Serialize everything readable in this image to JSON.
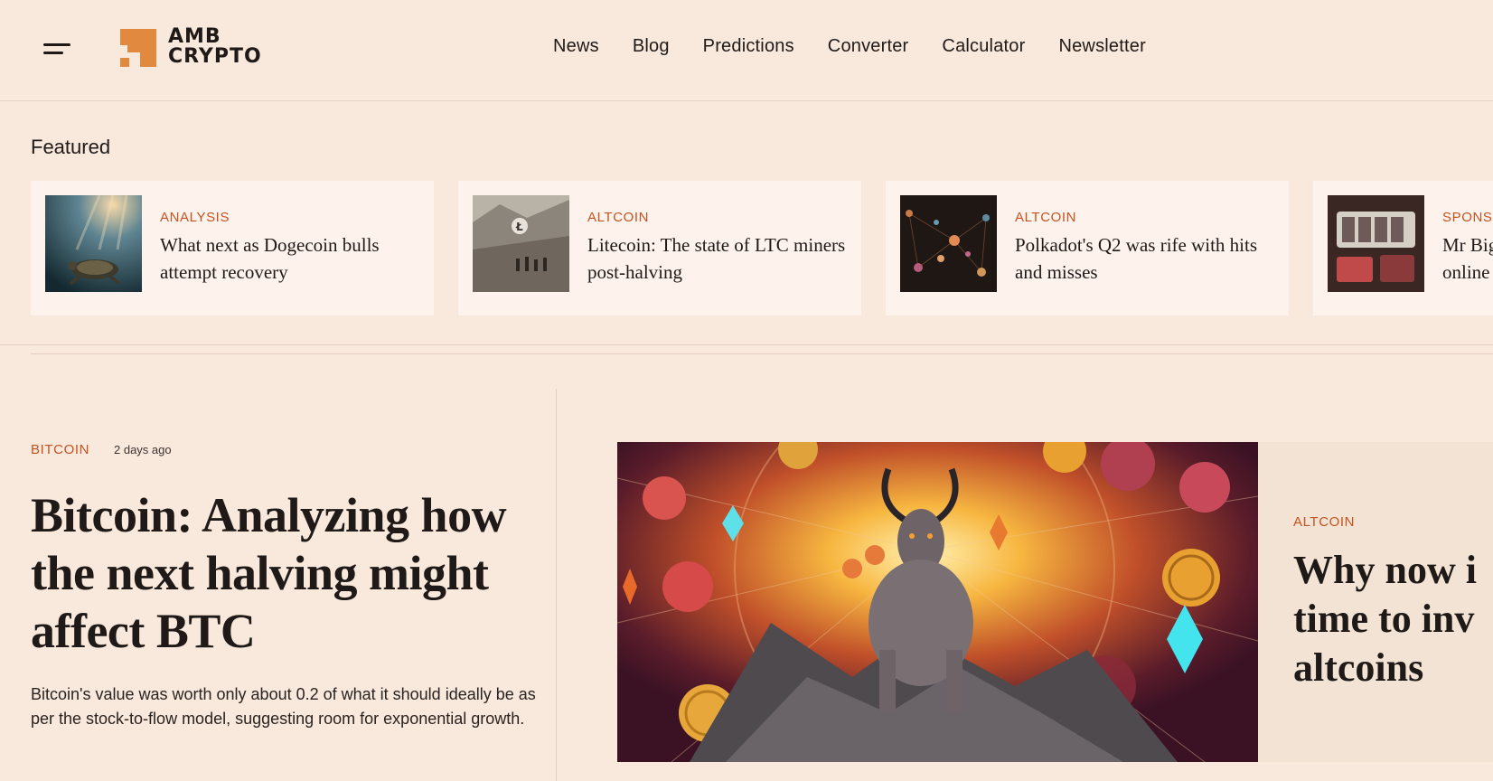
{
  "header": {
    "logo_line1": "AMB",
    "logo_line2": "CRYPTO",
    "nav": [
      "News",
      "Blog",
      "Predictions",
      "Converter",
      "Calculator",
      "Newsletter"
    ]
  },
  "featured": {
    "heading": "Featured",
    "cards": [
      {
        "category": "ANALYSIS",
        "title": "What next as Dogecoin bulls attempt recovery",
        "image": "turtle-underwater"
      },
      {
        "category": "ALTCOIN",
        "title": "Litecoin: The state of LTC miners post-halving",
        "image": "miners-quarry"
      },
      {
        "category": "ALTCOIN",
        "title": "Polkadot's Q2 was rife with hits and misses",
        "image": "network-dots"
      },
      {
        "category": "SPONS",
        "title": "Mr Big online",
        "image": "slot-machine"
      }
    ]
  },
  "lead": {
    "category": "BITCOIN",
    "time": "2 days ago",
    "title": "Bitcoin: Analyzing how the next halving might affect BTC",
    "excerpt": "Bitcoin's value was worth only about 0.2 of what it should ideally be as per the stock-to-flow model, suggesting room for exponential growth."
  },
  "second": {
    "category": "ALTCOIN",
    "title_lines": [
      "Why now i",
      "time to inv",
      "altcoins"
    ],
    "image": "bull-with-coins"
  },
  "colors": {
    "background": "#f9e8dc",
    "card": "#fdf3ec",
    "accent": "#c5521f",
    "logo_orange": "#e0893f",
    "text": "#1f1a17"
  }
}
